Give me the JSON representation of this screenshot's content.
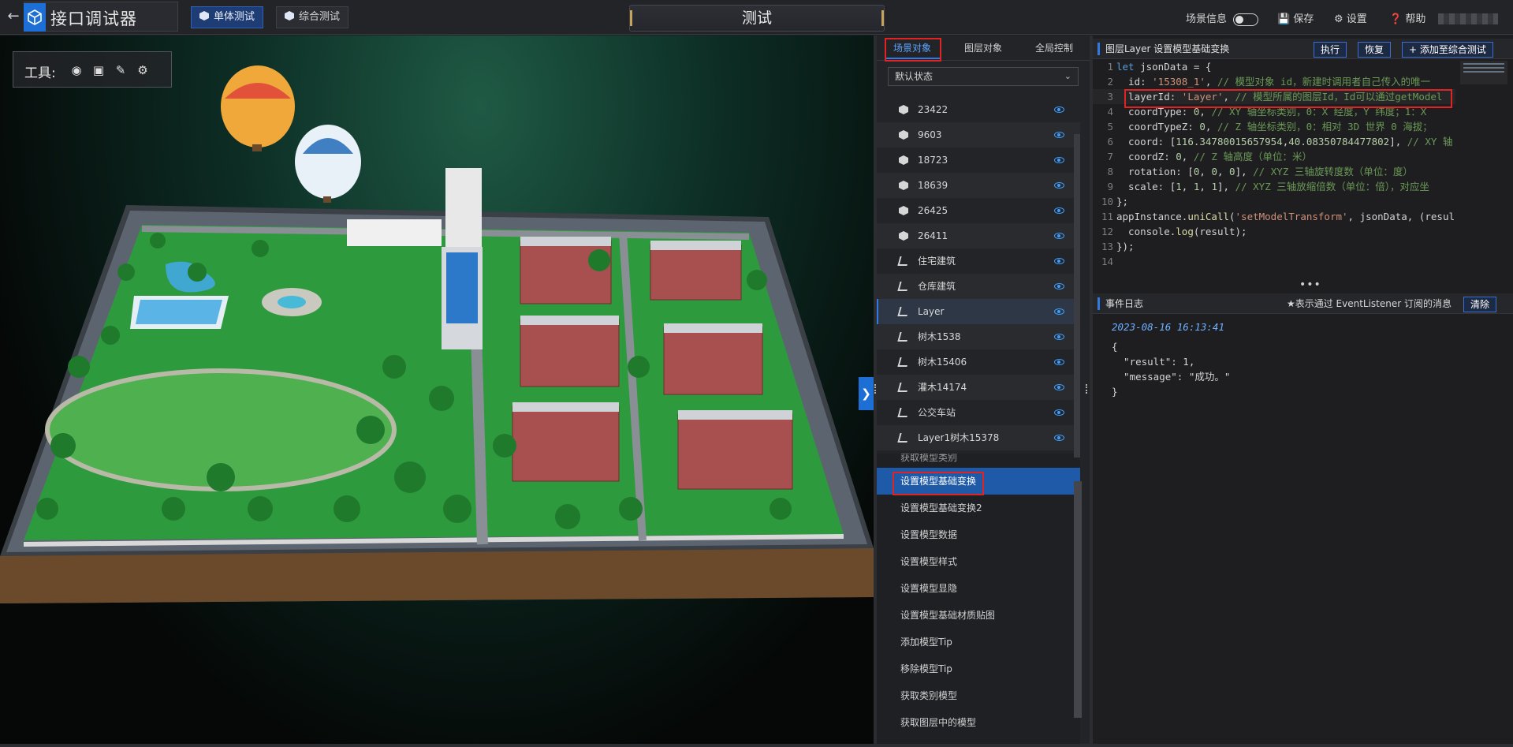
{
  "header": {
    "app_title": "接口调试器",
    "mode_single": "单体测试",
    "mode_combined": "综合测试",
    "center_title": "测试",
    "scene_info": "场景信息",
    "save": "保存",
    "settings": "设置",
    "help": "帮助"
  },
  "toolbox": {
    "label": "工具:"
  },
  "objects_panel": {
    "tabs": [
      "场景对象",
      "图层对象",
      "全局控制"
    ],
    "active_tab": 0,
    "state_select": "默认状态",
    "items": [
      {
        "name": "23422",
        "icon": "box"
      },
      {
        "name": "9603",
        "icon": "box"
      },
      {
        "name": "18723",
        "icon": "box"
      },
      {
        "name": "18639",
        "icon": "box"
      },
      {
        "name": "26425",
        "icon": "box"
      },
      {
        "name": "26411",
        "icon": "box"
      },
      {
        "name": "住宅建筑",
        "icon": "layer"
      },
      {
        "name": "仓库建筑",
        "icon": "layer"
      },
      {
        "name": "Layer",
        "icon": "layer",
        "selected": true
      },
      {
        "name": "树木1538",
        "icon": "layer"
      },
      {
        "name": "树木15406",
        "icon": "layer"
      },
      {
        "name": "灌木14174",
        "icon": "layer"
      },
      {
        "name": "公交车站",
        "icon": "layer"
      },
      {
        "name": "Layer1树木15378",
        "icon": "layer"
      }
    ]
  },
  "functions": {
    "partial_item": "获取模型类别",
    "items": [
      "设置模型基础变换",
      "设置模型基础变换2",
      "设置模型数据",
      "设置模型样式",
      "设置模型显隐",
      "设置模型基础材质贴图",
      "添加模型Tip",
      "移除模型Tip",
      "获取类别模型",
      "获取图层中的模型"
    ],
    "active_index": 0
  },
  "editor": {
    "title": "图层Layer 设置模型基础变换",
    "run": "执行",
    "reset": "恢复",
    "add_to_combined": "添加至综合测试",
    "code_lines": [
      "let jsonData = {",
      "  id: '15308_1', // 模型对象 id，新建时调用者自己传入的唯一",
      "  layerId: 'Layer', // 模型所属的图层Id，Id可以通过getModel",
      "  coordType: 0, // XY 轴坐标类别，0：X 经度，Y 纬度；1：X",
      "  coordTypeZ: 0, // Z 轴坐标类别，0：相对 3D 世界 0 海拔；",
      "  coord: [116.34780015657954,40.08350784477802], // XY 轴",
      "  coordZ: 0, // Z 轴高度（单位：米）",
      "  rotation: [0, 0, 0], // XYZ 三轴旋转度数（单位：度）",
      "  scale: [1, 1, 1], // XYZ 三轴放缩倍数（单位：倍），对应坐",
      "};",
      "appInstance.uniCall('setModelTransform', jsonData, (resul",
      "  console.log(result);",
      "});",
      ""
    ],
    "current_line": 3
  },
  "event_log": {
    "title": "事件日志",
    "hint": "★表示通过 EventListener 订阅的消息",
    "clear": "清除",
    "timestamp": "2023-08-16 16:13:41",
    "body": "{\n  \"result\": 1,\n  \"message\": \"成功。\"\n}"
  },
  "colors": {
    "accent": "#2f7ae5",
    "highlight_box": "#e02424",
    "active_func": "#1f5aa8"
  }
}
